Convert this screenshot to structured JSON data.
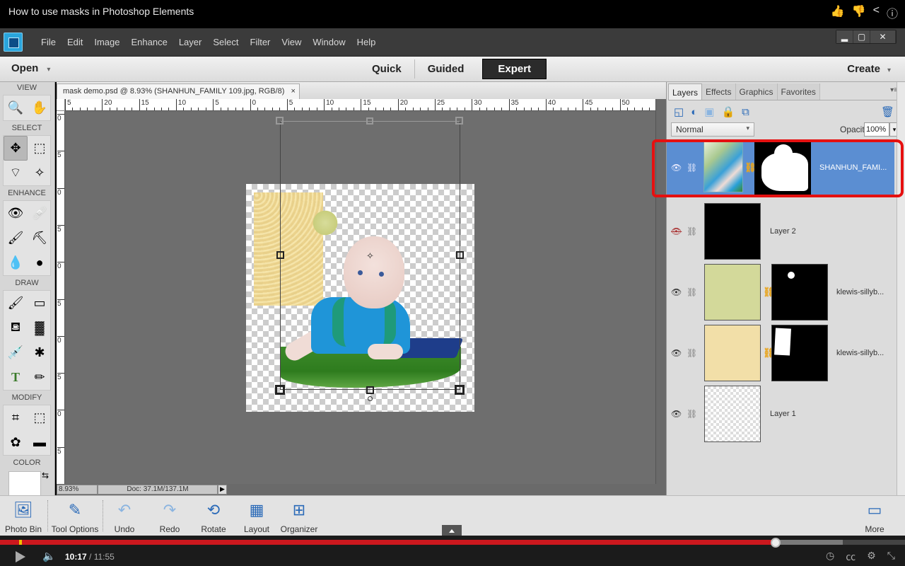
{
  "video": {
    "title": "How to use masks in Photoshop Elements",
    "actions": [
      "like-icon",
      "dislike-icon",
      "share-icon",
      "info-icon"
    ],
    "current_time": "10:17",
    "separator": " / ",
    "duration": "11:55",
    "played_fraction": 0.857,
    "buffered_fraction": 0.931
  },
  "app": {
    "menu": [
      "File",
      "Edit",
      "Image",
      "Enhance",
      "Layer",
      "Select",
      "Filter",
      "View",
      "Window",
      "Help"
    ],
    "window_controls": {
      "minimize": "▂",
      "maximize": "▢",
      "close": "✕"
    },
    "open_label": "Open",
    "create_label": "Create",
    "dropdown_glyph": "▾",
    "modes": [
      {
        "label": "Quick",
        "active": false
      },
      {
        "label": "Guided",
        "active": false
      },
      {
        "label": "Expert",
        "active": true
      }
    ]
  },
  "toolbox": {
    "sections": {
      "view": "VIEW",
      "select": "SELECT",
      "enhance": "ENHANCE",
      "draw": "DRAW",
      "modify": "MODIFY",
      "color": "COLOR"
    },
    "tools": {
      "view": [
        "🔍",
        "✋"
      ],
      "select": [
        "✥",
        "⬚",
        "⌔",
        "✧"
      ],
      "enhance": [
        "👁",
        "🩹",
        "🖌",
        "⛏",
        "💧",
        "●"
      ],
      "draw": [
        "🖌",
        "▭",
        "⛾",
        "▓",
        "💉",
        "✱",
        "T",
        "✏"
      ],
      "modify": [
        "⌗",
        "⬚",
        "✿",
        "▬"
      ]
    },
    "swap_glyph": "⇆"
  },
  "document": {
    "tab_label": "mask demo.psd @ 8.93% (SHANHUN_FAMILY 109.jpg, RGB/8)",
    "close_glyph": "×",
    "hruler_labels": [
      "5",
      "20",
      "15",
      "10",
      "5",
      "0",
      "5",
      "10",
      "15",
      "20",
      "25",
      "30",
      "35",
      "40",
      "45",
      "50"
    ],
    "vruler_labels": [
      "0",
      "5",
      "0",
      "5",
      "0",
      "5",
      "0",
      "5",
      "0",
      "5"
    ],
    "zoom": "8.93%",
    "doc_size": "Doc: 37.1M/137.1M",
    "status_arrow": "▶"
  },
  "layers_panel": {
    "tabs": [
      {
        "label": "Layers",
        "active": true
      },
      {
        "label": "Effects",
        "active": false
      },
      {
        "label": "Graphics",
        "active": false
      },
      {
        "label": "Favorites",
        "active": false
      }
    ],
    "panel_menu": "▾≡",
    "toolbar_icons": [
      "new-layer-icon",
      "adjustment-layer-icon",
      "add-mask-icon",
      "lock-all-icon",
      "lock-transparency-icon",
      "delete-layer-icon"
    ],
    "blend_mode": "Normal",
    "opacity_label": "Opacity:",
    "opacity_value": "100%",
    "layers": [
      {
        "name": "SHANHUN_FAMI...",
        "visible": true,
        "selected": true,
        "has_mask": true,
        "thumb": "photo",
        "mask": "baby-silhouette"
      },
      {
        "name": "Layer 2",
        "visible": false,
        "selected": false,
        "has_mask": false,
        "thumb": "black"
      },
      {
        "name": "klewis-sillyb...",
        "visible": true,
        "selected": false,
        "has_mask": true,
        "thumb": "green-paper",
        "mask": "small-flower"
      },
      {
        "name": "klewis-sillyb...",
        "visible": true,
        "selected": false,
        "has_mask": true,
        "thumb": "yellow-paper",
        "mask": "rectangle"
      },
      {
        "name": "Layer 1",
        "visible": true,
        "selected": false,
        "has_mask": false,
        "thumb": "transparent"
      }
    ]
  },
  "taskbar": {
    "items": [
      {
        "label": "Photo Bin",
        "icon": "🖼"
      },
      {
        "label": "Tool Options",
        "icon": "✎"
      },
      {
        "label": "Undo",
        "icon": "↶"
      },
      {
        "label": "Redo",
        "icon": "↷"
      },
      {
        "label": "Rotate",
        "icon": "⟲"
      },
      {
        "label": "Layout",
        "icon": "▦"
      },
      {
        "label": "Organizer",
        "icon": "⊞"
      },
      {
        "label": "More",
        "icon": "▭"
      }
    ]
  },
  "colors": {
    "accent_selection": "#5b8ed2",
    "annotation_red": "#e51010",
    "progress_red": "#cc181e",
    "link_chain": "#e8a520"
  }
}
